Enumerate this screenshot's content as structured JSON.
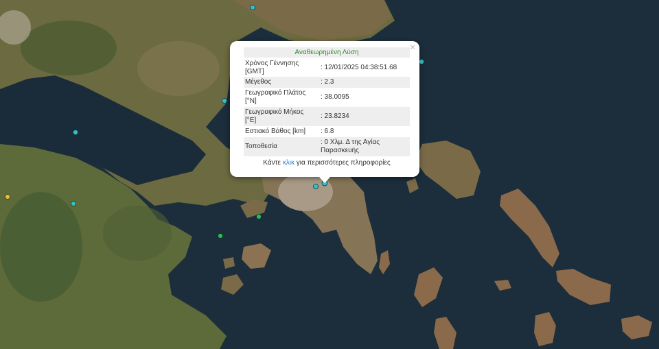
{
  "colors": {
    "sea": "#1c2e3c",
    "land": "#6b6a40",
    "mountain": "#8a6a4a",
    "forest": "#3e5a30",
    "city": "#a89a86",
    "marker_cyan": "#35c0c8",
    "marker_green": "#2db85c",
    "marker_yellow": "#e0c040",
    "popup_title": "#2e8b2e",
    "link": "#2a7fd4"
  },
  "popup": {
    "title": "Αναθεωρημένη Λύση",
    "close": "×",
    "rows": [
      {
        "label": "Χρόνος Γέννησης [GMT]",
        "value": ": 12/01/2025 04:38:51.68"
      },
      {
        "label": "Μέγεθος",
        "value": ": 2.3"
      },
      {
        "label": "Γεωγραφικό Πλάτος [°N]",
        "value": ": 38.0095"
      },
      {
        "label": "Γεωγραφικό Μήκος [°E]",
        "value": ": 23.8234"
      },
      {
        "label": "Εστιακό Βάθος [km]",
        "value": ": 6.8"
      },
      {
        "label": "Τοποθεσία",
        "value": ": 0 Χλμ. Δ της Αγίας Παρασκευής"
      }
    ],
    "more_prefix": "Κάντε ",
    "more_link": "κλικ",
    "more_suffix": " για περισσότερες πληροφορίες"
  },
  "markers": [
    {
      "id": "m1",
      "color": "cyan"
    },
    {
      "id": "m2",
      "color": "cyan"
    },
    {
      "id": "m3",
      "color": "cyan"
    },
    {
      "id": "m4",
      "color": "cyan"
    },
    {
      "id": "m5",
      "color": "cyan"
    },
    {
      "id": "m6",
      "color": "yellow"
    },
    {
      "id": "m7",
      "color": "cyan"
    },
    {
      "id": "m8",
      "color": "cyan"
    },
    {
      "id": "m9",
      "color": "green"
    },
    {
      "id": "m10",
      "color": "green"
    }
  ]
}
